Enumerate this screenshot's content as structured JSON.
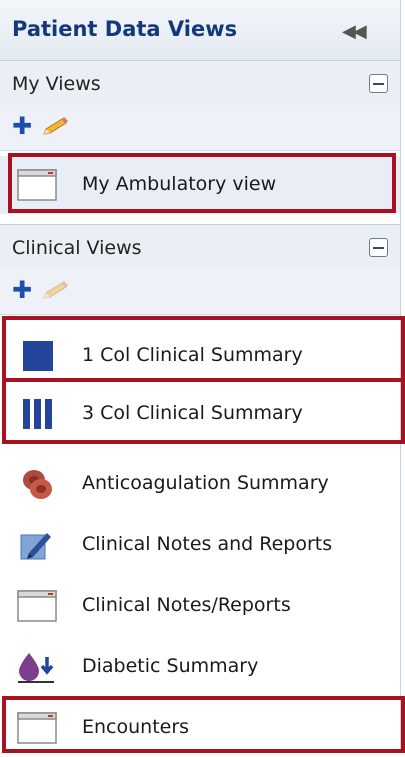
{
  "panel": {
    "title": "Patient Data Views",
    "collapse_icon": "double-chevron-left-icon"
  },
  "my_views": {
    "label": "My Views",
    "toolbar": {
      "add_icon": "plus-icon",
      "edit_icon": "pencil-icon"
    },
    "items": [
      {
        "label": "My Ambulatory view",
        "icon": "blank-document-icon",
        "selected": true
      }
    ]
  },
  "clinical_views": {
    "label": "Clinical Views",
    "toolbar": {
      "add_icon": "plus-icon",
      "edit_icon": "pencil-icon"
    },
    "items": [
      {
        "label": "1 Col Clinical Summary",
        "icon": "single-column-icon"
      },
      {
        "label": "3 Col Clinical Summary",
        "icon": "three-column-icon"
      },
      {
        "label": "Anticoagulation Summary",
        "icon": "blood-cells-icon"
      },
      {
        "label": "Clinical Notes and Reports",
        "icon": "note-pen-icon"
      },
      {
        "label": "Clinical Notes/Reports",
        "icon": "blank-document-icon"
      },
      {
        "label": "Diabetic Summary",
        "icon": "blood-drop-icon"
      },
      {
        "label": "Encounters",
        "icon": "blank-document-icon"
      }
    ]
  },
  "colors": {
    "title": "#15387a",
    "accent": "#1b4fa8",
    "highlight_border": "#a81120",
    "header_bg": "#eaeff6"
  }
}
